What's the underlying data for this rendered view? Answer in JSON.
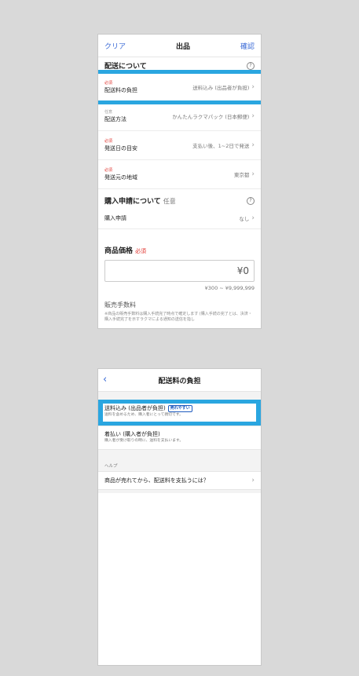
{
  "listing": {
    "nav": {
      "left": "クリア",
      "title": "出品",
      "right": "確認"
    },
    "shipping_section": {
      "title": "配送について",
      "help": "?"
    },
    "rows": [
      {
        "tag": "必須",
        "label": "配送料の負担",
        "value": "送料込み (出品者が負担)"
      },
      {
        "tag": "任意",
        "label": "配送方法",
        "value": "かんたんラクマパック (日本郵便)"
      },
      {
        "tag": "必須",
        "label": "発送日の目安",
        "value": "支払い後、1~2日で発送"
      },
      {
        "tag": "必須",
        "label": "発送元の地域",
        "value": "東京都"
      }
    ],
    "purchase_section": {
      "title": "購入申請について",
      "optional": "任意",
      "help": "?"
    },
    "purchase_row": {
      "label": "購入申請",
      "value": "なし"
    },
    "price": {
      "title": "商品価格",
      "required": "必須",
      "value": "¥0",
      "range": "¥300 ~ ¥9,999,999"
    },
    "fee": {
      "title": "販売手数料",
      "note": "※商品の販売手数料は購入手続完了時点で確定します (購入手続の完了とは、決済・購入手続完了を示すラクマによる通知の送信を指し"
    }
  },
  "shipping_fee": {
    "nav": {
      "back": "‹",
      "title": "配送料の負担"
    },
    "options": [
      {
        "title": "送料込み (出品者が負担)",
        "badge": "売れやすい",
        "sub": "送料を含めるため、購入者にとって親切です。"
      },
      {
        "title": "着払い (購入者が負担)",
        "sub": "購入者が受け取りの時に、送料を支払います。"
      }
    ],
    "help_header": "ヘルプ",
    "help_item": "商品が売れてから、配送料を支払うには？"
  },
  "colors": {
    "highlight": "#2aa6e0",
    "accent": "#3a6ad6",
    "required": "#e0342e"
  }
}
